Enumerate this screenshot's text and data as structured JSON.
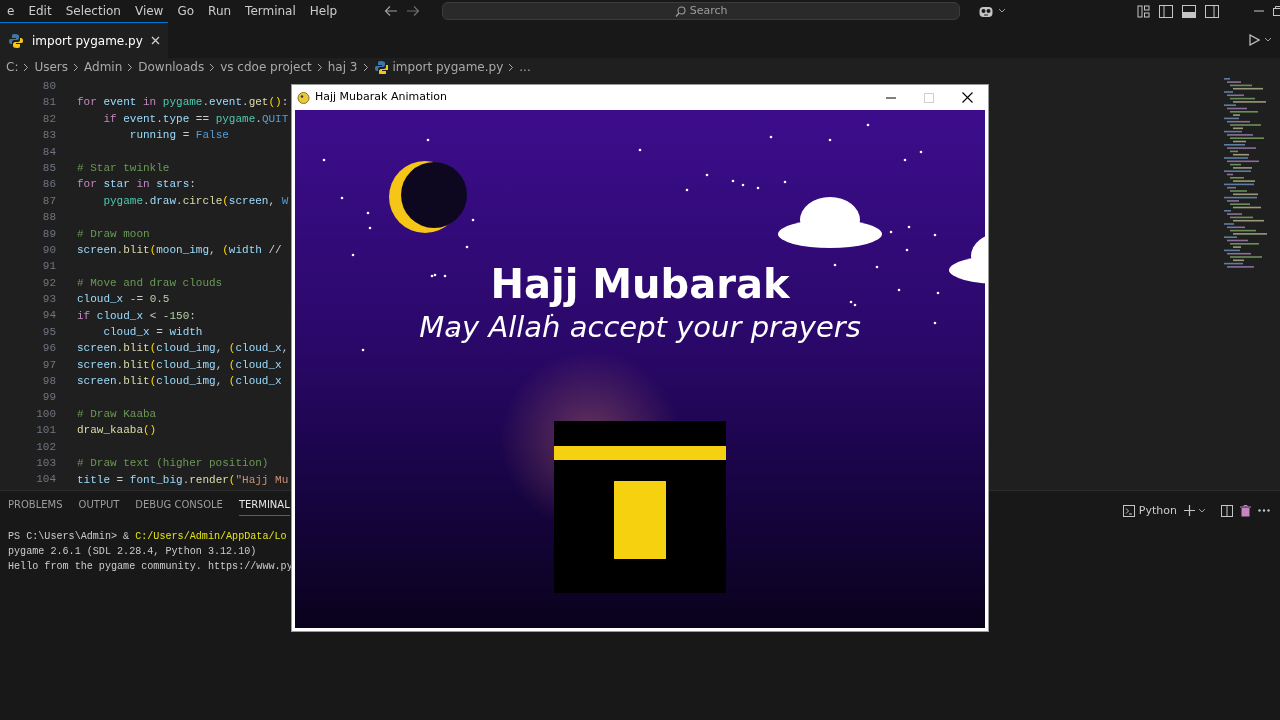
{
  "menu_bar": {
    "items": [
      "e",
      "Edit",
      "Selection",
      "View",
      "Go",
      "Run",
      "Terminal",
      "Help"
    ]
  },
  "command_center": {
    "placeholder": "Search"
  },
  "editor_tabs": [
    {
      "label": "import pygame.py",
      "selected": true
    }
  ],
  "breadcrumb": [
    {
      "label": "C:",
      "kind": "folder"
    },
    {
      "label": "Users",
      "kind": "folder"
    },
    {
      "label": "Admin",
      "kind": "folder"
    },
    {
      "label": "Downloads",
      "kind": "folder"
    },
    {
      "label": "vs cdoe project",
      "kind": "folder"
    },
    {
      "label": "haj 3",
      "kind": "folder"
    },
    {
      "label": "import pygame.py",
      "kind": "file"
    },
    {
      "label": "...",
      "kind": "more"
    }
  ],
  "code_lines": [
    {
      "number": "80"
    },
    {
      "number": "81",
      "tokens": [
        {
          "text": "for ",
          "kind": "kw"
        },
        {
          "text": "event ",
          "kind": "var"
        },
        {
          "text": "in ",
          "kind": "kw"
        },
        {
          "text": "pygame",
          "kind": "cls"
        },
        {
          "text": ".",
          "kind": "op"
        },
        {
          "text": "event",
          "kind": "var"
        },
        {
          "text": ".",
          "kind": "op"
        },
        {
          "text": "get",
          "kind": "fn"
        },
        {
          "text": "()",
          "kind": "paren"
        },
        {
          "text": ":",
          "kind": "op"
        }
      ]
    },
    {
      "number": "82",
      "tokens": [
        {
          "text": "    if ",
          "kind": "kw"
        },
        {
          "text": "event",
          "kind": "var"
        },
        {
          "text": ".",
          "kind": "op"
        },
        {
          "text": "type",
          "kind": "var"
        },
        {
          "text": " == ",
          "kind": "op"
        },
        {
          "text": "pygame",
          "kind": "cls"
        },
        {
          "text": ".",
          "kind": "op"
        },
        {
          "text": "QUIT",
          "kind": "const"
        }
      ]
    },
    {
      "number": "83",
      "tokens": [
        {
          "text": "        running",
          "kind": "var"
        },
        {
          "text": " = ",
          "kind": "op"
        },
        {
          "text": "False",
          "kind": "const"
        }
      ]
    },
    {
      "number": "84"
    },
    {
      "number": "85",
      "tokens": [
        {
          "text": "# Star twinkle",
          "kind": "com"
        }
      ]
    },
    {
      "number": "86",
      "tokens": [
        {
          "text": "for ",
          "kind": "kw"
        },
        {
          "text": "star ",
          "kind": "var"
        },
        {
          "text": "in ",
          "kind": "kw"
        },
        {
          "text": "stars",
          "kind": "var"
        },
        {
          "text": ":",
          "kind": "op"
        }
      ]
    },
    {
      "number": "87",
      "tokens": [
        {
          "text": "    pygame",
          "kind": "cls"
        },
        {
          "text": ".",
          "kind": "op"
        },
        {
          "text": "draw",
          "kind": "var"
        },
        {
          "text": ".",
          "kind": "op"
        },
        {
          "text": "circle",
          "kind": "fn"
        },
        {
          "text": "(",
          "kind": "paren"
        },
        {
          "text": "screen",
          "kind": "var"
        },
        {
          "text": ", ",
          "kind": "op"
        },
        {
          "text": "W",
          "kind": "const"
        }
      ]
    },
    {
      "number": "88"
    },
    {
      "number": "89",
      "tokens": [
        {
          "text": "# Draw moon",
          "kind": "com"
        }
      ]
    },
    {
      "number": "90",
      "tokens": [
        {
          "text": "screen",
          "kind": "var"
        },
        {
          "text": ".",
          "kind": "op"
        },
        {
          "text": "blit",
          "kind": "fn"
        },
        {
          "text": "(",
          "kind": "paren"
        },
        {
          "text": "moon_img",
          "kind": "var"
        },
        {
          "text": ", ",
          "kind": "op"
        },
        {
          "text": "(",
          "kind": "paren"
        },
        {
          "text": "width",
          "kind": "var"
        },
        {
          "text": " //",
          "kind": "op"
        }
      ]
    },
    {
      "number": "91"
    },
    {
      "number": "92",
      "tokens": [
        {
          "text": "# Move and draw clouds",
          "kind": "com"
        }
      ]
    },
    {
      "number": "93",
      "tokens": [
        {
          "text": "cloud_x",
          "kind": "var"
        },
        {
          "text": " -= ",
          "kind": "op"
        },
        {
          "text": "0.5",
          "kind": "num"
        }
      ]
    },
    {
      "number": "94",
      "tokens": [
        {
          "text": "if ",
          "kind": "kw"
        },
        {
          "text": "cloud_x",
          "kind": "var"
        },
        {
          "text": " < -",
          "kind": "op"
        },
        {
          "text": "150",
          "kind": "num"
        },
        {
          "text": ":",
          "kind": "op"
        }
      ]
    },
    {
      "number": "95",
      "tokens": [
        {
          "text": "    cloud_x",
          "kind": "var"
        },
        {
          "text": " = ",
          "kind": "op"
        },
        {
          "text": "width",
          "kind": "var"
        }
      ]
    },
    {
      "number": "96",
      "tokens": [
        {
          "text": "screen",
          "kind": "var"
        },
        {
          "text": ".",
          "kind": "op"
        },
        {
          "text": "blit",
          "kind": "fn"
        },
        {
          "text": "(",
          "kind": "paren"
        },
        {
          "text": "cloud_img",
          "kind": "var"
        },
        {
          "text": ", ",
          "kind": "op"
        },
        {
          "text": "(",
          "kind": "paren"
        },
        {
          "text": "cloud_x",
          "kind": "var"
        },
        {
          "text": ",",
          "kind": "op"
        }
      ]
    },
    {
      "number": "97",
      "tokens": [
        {
          "text": "screen",
          "kind": "var"
        },
        {
          "text": ".",
          "kind": "op"
        },
        {
          "text": "blit",
          "kind": "fn"
        },
        {
          "text": "(",
          "kind": "paren"
        },
        {
          "text": "cloud_img",
          "kind": "var"
        },
        {
          "text": ", ",
          "kind": "op"
        },
        {
          "text": "(",
          "kind": "paren"
        },
        {
          "text": "cloud_x",
          "kind": "var"
        }
      ]
    },
    {
      "number": "98",
      "tokens": [
        {
          "text": "screen",
          "kind": "var"
        },
        {
          "text": ".",
          "kind": "op"
        },
        {
          "text": "blit",
          "kind": "fn"
        },
        {
          "text": "(",
          "kind": "paren"
        },
        {
          "text": "cloud_img",
          "kind": "var"
        },
        {
          "text": ", ",
          "kind": "op"
        },
        {
          "text": "(",
          "kind": "paren"
        },
        {
          "text": "cloud_x",
          "kind": "var"
        }
      ]
    },
    {
      "number": "99"
    },
    {
      "number": "100",
      "tokens": [
        {
          "text": "# Draw Kaaba",
          "kind": "com"
        }
      ]
    },
    {
      "number": "101",
      "tokens": [
        {
          "text": "draw_kaaba",
          "kind": "fn"
        },
        {
          "text": "()",
          "kind": "paren"
        }
      ]
    },
    {
      "number": "102"
    },
    {
      "number": "103",
      "tokens": [
        {
          "text": "# Draw text (higher position)",
          "kind": "com"
        }
      ]
    },
    {
      "number": "104",
      "tokens": [
        {
          "text": "title",
          "kind": "var"
        },
        {
          "text": " = ",
          "kind": "op"
        },
        {
          "text": "font_big",
          "kind": "var"
        },
        {
          "text": ".",
          "kind": "op"
        },
        {
          "text": "render",
          "kind": "fn"
        },
        {
          "text": "(",
          "kind": "paren"
        },
        {
          "text": "\"Hajj Mu",
          "kind": "str"
        }
      ]
    }
  ],
  "panel_tabs": [
    {
      "label": "PROBLEMS",
      "selected": false
    },
    {
      "label": "OUTPUT",
      "selected": false
    },
    {
      "label": "DEBUG CONSOLE",
      "selected": false
    },
    {
      "label": "TERMINAL",
      "selected": true
    }
  ],
  "terminal": {
    "profile": "Python",
    "lines": [
      {
        "segments": [
          {
            "text": "PS C:\\Users\\Admin> & ",
            "kind": "plain"
          },
          {
            "text": "C:/Users/Admin/AppData/Lo",
            "kind": "path"
          }
        ]
      },
      {
        "segments": [
          {
            "text": "pygame 2.6.1 (SDL 2.28.4, Python 3.12.10)",
            "kind": "plain"
          }
        ]
      },
      {
        "segments": [
          {
            "text": "Hello from the pygame community. https://www.py",
            "kind": "plain"
          }
        ]
      }
    ]
  },
  "app_window": {
    "title": "Hajj Mubarak Animation",
    "heading": "Hajj Mubarak",
    "subheading": "May Allah accept your prayers"
  }
}
